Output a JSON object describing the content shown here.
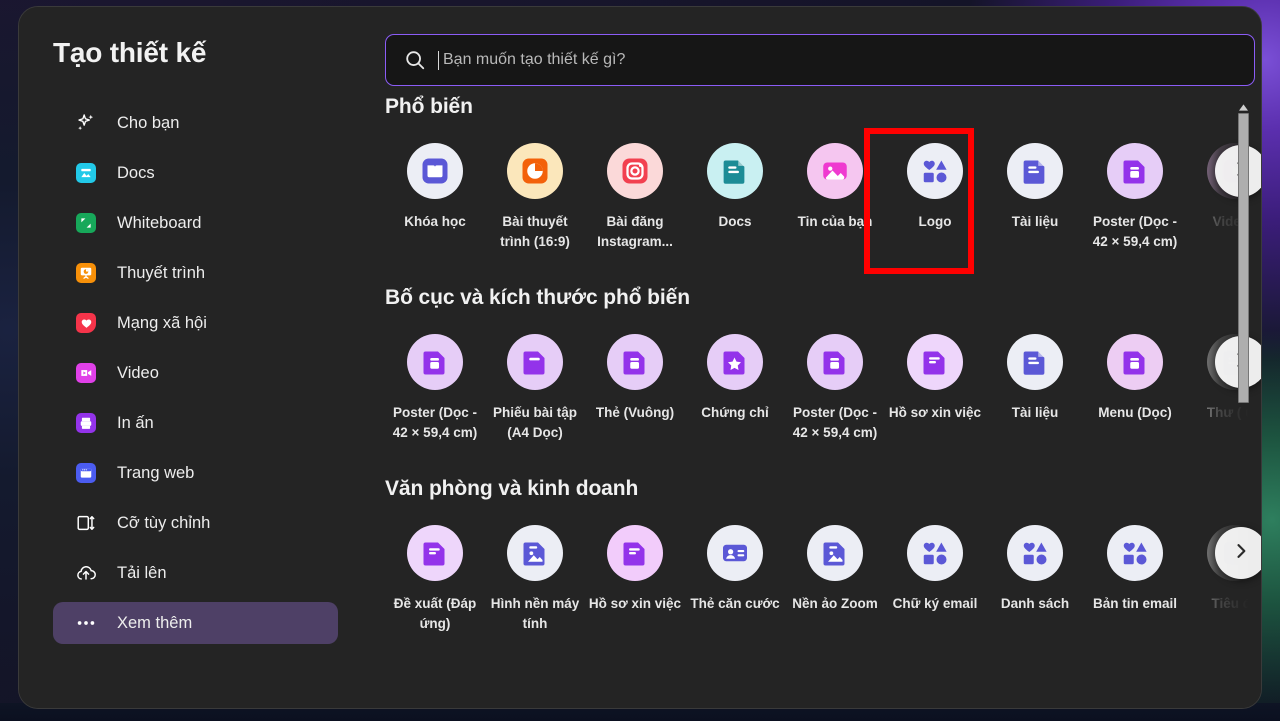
{
  "app": {
    "title": "Tạo thiết kế"
  },
  "search": {
    "placeholder": "Bạn muốn tạo thiết kế gì?",
    "value": "",
    "icon": "search-icon"
  },
  "sidebar": {
    "items": [
      {
        "label": "Cho bạn",
        "icon": "sparkle-icon",
        "color": "#ffffff",
        "active": false
      },
      {
        "label": "Docs",
        "icon": "docs-icon",
        "color": "#22c9e8",
        "active": false
      },
      {
        "label": "Whiteboard",
        "icon": "whiteboard-icon",
        "color": "#17a85a",
        "active": false
      },
      {
        "label": "Thuyết trình",
        "icon": "presentation-icon",
        "color": "#f79009",
        "active": false
      },
      {
        "label": "Mạng xã hội",
        "icon": "social-heart-icon",
        "color": "#f5344a",
        "active": false
      },
      {
        "label": "Video",
        "icon": "video-icon",
        "color": "#e040e8",
        "active": false
      },
      {
        "label": "In ấn",
        "icon": "print-icon",
        "color": "#9333ea",
        "active": false
      },
      {
        "label": "Trang web",
        "icon": "website-icon",
        "color": "#4b5cf0",
        "active": false
      },
      {
        "label": "Cỡ tùy chỉnh",
        "icon": "custom-size-icon",
        "color": "#ffffff",
        "active": false
      },
      {
        "label": "Tải lên",
        "icon": "upload-cloud-icon",
        "color": "#ffffff",
        "active": false
      },
      {
        "label": "Xem thêm",
        "icon": "more-dots-icon",
        "color": "#ffffff",
        "active": true
      }
    ]
  },
  "colors": {
    "accent_purple": "#8b5cf6",
    "panel_bg": "#242424",
    "active_nav": "#4e4066",
    "highlight_box": "#ff0000"
  },
  "sections": [
    {
      "title": "Phổ biến",
      "has_arrow": true,
      "tiles": [
        {
          "label": "Khóa học",
          "icon": "book-icon",
          "bubble": "#eceef5",
          "glyph": "#5b58d6"
        },
        {
          "label": "Bài thuyết trình (16:9)",
          "icon": "pie-chart-icon",
          "bubble": "#fbe7bb",
          "glyph": "#f3610a"
        },
        {
          "label": "Bài đăng Instagram...",
          "icon": "instagram-icon",
          "bubble": "#fbd9d9",
          "glyph": "#f2404f"
        },
        {
          "label": "Docs",
          "icon": "doc-icon",
          "bubble": "#c9f0f2",
          "glyph": "#1c8c96"
        },
        {
          "label": "Tin của bạn",
          "icon": "image-icon",
          "bubble": "#f5c6f0",
          "glyph": "#ef3ad0"
        },
        {
          "label": "Logo",
          "icon": "shapes-icon",
          "bubble": "#eceef5",
          "glyph": "#5b58d6",
          "highlighted": true
        },
        {
          "label": "Tài liệu",
          "icon": "doc-icon",
          "bubble": "#eceef5",
          "glyph": "#5b58d6"
        },
        {
          "label": "Poster (Dọc - 42 × 59,4 cm)",
          "icon": "poster-icon",
          "bubble": "#e6cdf7",
          "glyph": "#9333ea"
        },
        {
          "label": "Video (",
          "icon": "video-play-icon",
          "bubble": "#e6b9ec",
          "glyph": "#a21fb8"
        }
      ]
    },
    {
      "title": "Bố cục và kích thước phổ biến",
      "has_arrow": true,
      "tiles": [
        {
          "label": "Poster (Dọc - 42 × 59,4 cm)",
          "icon": "poster-icon",
          "bubble": "#e6cdf7",
          "glyph": "#9333ea"
        },
        {
          "label": "Phiếu bài tập (A4 Dọc)",
          "icon": "worksheet-icon",
          "bubble": "#e6cdf7",
          "glyph": "#9333ea"
        },
        {
          "label": "Thẻ (Vuông)",
          "icon": "poster-icon",
          "bubble": "#e6cdf7",
          "glyph": "#9333ea"
        },
        {
          "label": "Chứng chỉ",
          "icon": "star-doc-icon",
          "bubble": "#e6cdf7",
          "glyph": "#9333ea"
        },
        {
          "label": "Poster (Dọc - 42 × 59,4 cm)",
          "icon": "poster-icon",
          "bubble": "#e6cdf7",
          "glyph": "#9333ea"
        },
        {
          "label": "Hồ sơ xin việc",
          "icon": "resume-icon",
          "bubble": "#eed6fb",
          "glyph": "#9333ea"
        },
        {
          "label": "Tài liệu",
          "icon": "doc-icon",
          "bubble": "#eceef5",
          "glyph": "#5b58d6"
        },
        {
          "label": "Menu (Dọc)",
          "icon": "poster-icon",
          "bubble": "#edcdf3",
          "glyph": "#9333ea"
        },
        {
          "label": "Thư ( ứn",
          "icon": "doc-icon",
          "bubble": "#dcdcdc",
          "glyph": "#4c4ab0"
        }
      ]
    },
    {
      "title": "Văn phòng và kinh doanh",
      "has_arrow": true,
      "tiles": [
        {
          "label": "Đề xuất (Đáp ứng)",
          "icon": "resume-icon",
          "bubble": "#eed6fb",
          "glyph": "#9333ea"
        },
        {
          "label": "Hình nền máy tính",
          "icon": "wallpaper-icon",
          "bubble": "#eceef5",
          "glyph": "#5b58d6"
        },
        {
          "label": "Hồ sơ xin việc",
          "icon": "resume-icon",
          "bubble": "#f2ccfb",
          "glyph": "#9333ea"
        },
        {
          "label": "Thẻ căn cước",
          "icon": "id-card-icon",
          "bubble": "#eceef5",
          "glyph": "#5b58d6"
        },
        {
          "label": "Nền ảo Zoom",
          "icon": "wallpaper-icon",
          "bubble": "#eceef5",
          "glyph": "#5b58d6"
        },
        {
          "label": "Chữ ký email",
          "icon": "shapes-icon",
          "bubble": "#eceef5",
          "glyph": "#5b58d6"
        },
        {
          "label": "Danh sách",
          "icon": "shapes-icon",
          "bubble": "#eceef5",
          "glyph": "#5b58d6"
        },
        {
          "label": "Bản tin email",
          "icon": "shapes-icon",
          "bubble": "#eceef5",
          "glyph": "#5b58d6"
        },
        {
          "label": "Tiêu đề",
          "icon": "video-play-icon",
          "bubble": "#dcdcdc",
          "glyph": "#4c4ab0"
        }
      ]
    }
  ],
  "scrollbar": {
    "icon": "scroll-up-arrow-icon"
  },
  "arrow_button": {
    "icon": "chevron-right-icon"
  }
}
